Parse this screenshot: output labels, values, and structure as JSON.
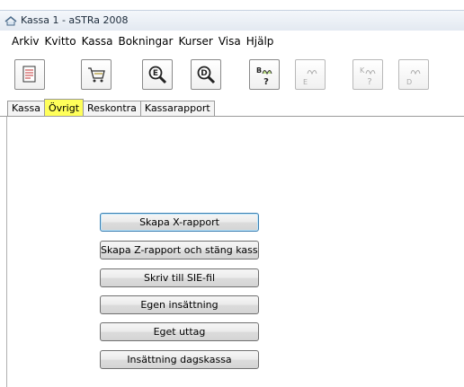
{
  "window": {
    "title": "Kassa 1 - aSTRa 2008"
  },
  "menu": [
    "Arkiv",
    "Kvitto",
    "Kassa",
    "Bokningar",
    "Kurser",
    "Visa",
    "Hjälp"
  ],
  "toolbar": {
    "buttons": [
      {
        "name": "receipt-icon"
      },
      {
        "name": "cart-icon"
      },
      {
        "name": "search-e-icon"
      },
      {
        "name": "search-d-icon"
      },
      {
        "name": "booking-b-icon"
      },
      {
        "name": "booking-e-icon"
      },
      {
        "name": "course-k-icon"
      },
      {
        "name": "course-d-icon"
      }
    ],
    "letters": {
      "b": "B",
      "e": "E",
      "k": "K",
      "d": "D",
      "q": "?"
    }
  },
  "tabs": [
    "Kassa",
    "Övrigt",
    "Reskontra",
    "Kassarapport"
  ],
  "active_tab": "Övrigt",
  "highlight_color": "#ffff5a",
  "buttons": {
    "x_report": "Skapa X-rapport",
    "z_report": "Skapa Z-rapport och stäng kassan",
    "sie_file": "Skriv till SIE-fil",
    "deposit": "Egen insättning",
    "withdrawal": "Eget uttag",
    "day_cash": "Insättning dagskassa"
  }
}
